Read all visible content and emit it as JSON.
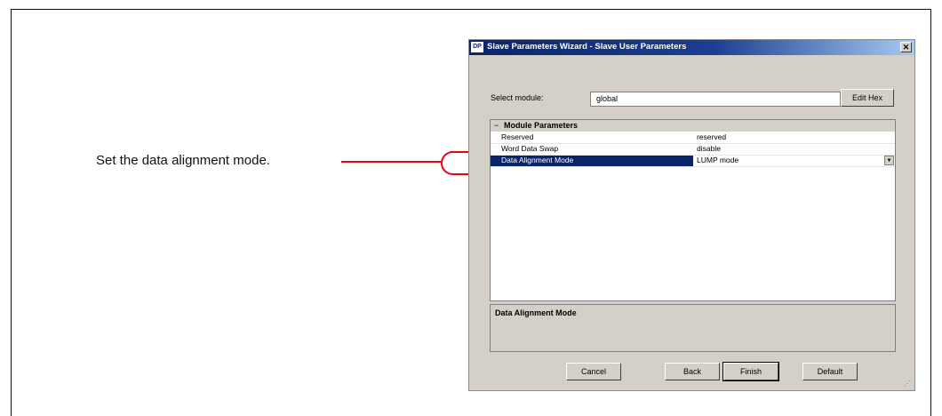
{
  "callout": {
    "text": "Set the data alignment mode."
  },
  "dialog": {
    "app_icon": "DP",
    "title": "Slave Parameters Wizard - Slave User Parameters",
    "close_glyph": "✕",
    "select_module_label": "Select module:",
    "select_module_value": "global",
    "edit_hex_label": "Edit Hex",
    "parameters": {
      "group_label": "Module Parameters",
      "rows": [
        {
          "name": "Reserved",
          "value": "reserved"
        },
        {
          "name": "Word Data Swap",
          "value": "disable"
        },
        {
          "name": "Data Alignment Mode",
          "value": "LUMP mode",
          "selected": true
        }
      ]
    },
    "description_title": "Data Alignment Mode",
    "buttons": {
      "cancel": "Cancel",
      "back": "Back",
      "finish": "Finish",
      "default": "Default"
    }
  },
  "colors": {
    "callout": "#e10613",
    "titlebar": "#0a246a",
    "selection": "#0a246a"
  }
}
